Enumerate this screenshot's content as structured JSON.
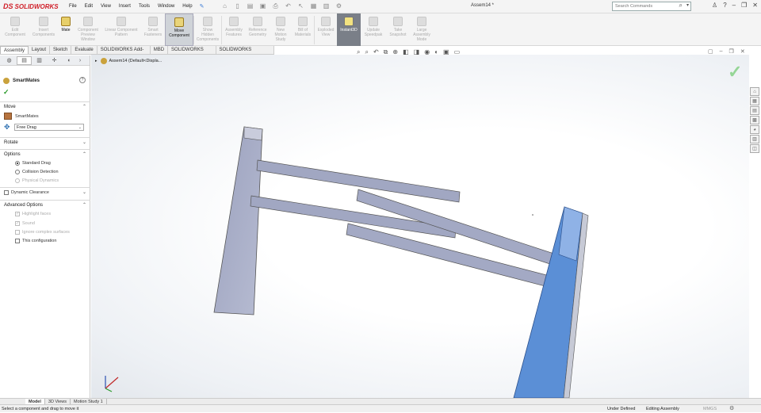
{
  "app": {
    "brand": "SOLIDWORKS",
    "brand_glyph": "DS",
    "doc_title": "Assem14 *"
  },
  "menu": [
    "File",
    "Edit",
    "View",
    "Insert",
    "Tools",
    "Window",
    "Help"
  ],
  "search": {
    "placeholder": "Search Commands"
  },
  "ribbon": [
    {
      "label": "Edit\nComponent",
      "state": "disabled"
    },
    {
      "label": "Insert\nComponents",
      "state": "disabled"
    },
    {
      "label": "Mate",
      "state": "active"
    },
    {
      "label": "Component\nPreview\nWindow",
      "state": "disabled"
    },
    {
      "label": "Linear Component\nPattern",
      "state": "disabled"
    },
    {
      "label": "Smart\nFasteners",
      "state": "disabled"
    },
    {
      "label": "Move\nComponent",
      "state": "pressed"
    },
    {
      "label": "Show\nHidden\nComponents",
      "state": "disabled"
    },
    {
      "label": "Assembly\nFeatures",
      "state": "disabled"
    },
    {
      "label": "Reference\nGeometry",
      "state": "disabled"
    },
    {
      "label": "New\nMotion\nStudy",
      "state": "disabled"
    },
    {
      "label": "Bill of\nMaterials",
      "state": "disabled"
    },
    {
      "label": "Exploded\nView",
      "state": "disabled"
    },
    {
      "label": "Instant3D",
      "state": "dark"
    },
    {
      "label": "Update\nSpeedpak",
      "state": "disabled"
    },
    {
      "label": "Take\nSnapshot",
      "state": "disabled"
    },
    {
      "label": "Large\nAssembly\nMode",
      "state": "disabled"
    }
  ],
  "command_tabs": [
    "Assembly",
    "Layout",
    "Sketch",
    "Evaluate",
    "SOLIDWORKS Add-Ins",
    "MBD",
    "SOLIDWORKS CAM",
    "SOLIDWORKS Inspection"
  ],
  "property_manager": {
    "title": "SmartMates",
    "sections": {
      "move": {
        "label": "Move",
        "smartmates": "SmartMates",
        "mode": "Free Drag"
      },
      "rotate": {
        "label": "Rotate"
      },
      "options": {
        "label": "Options",
        "standard_drag": "Standard Drag",
        "collision_detection": "Collision Detection",
        "physical_dynamics": "Physical Dynamics"
      },
      "dynamic_clearance": {
        "label": "Dynamic Clearance"
      },
      "advanced": {
        "label": "Advanced Options",
        "highlight_faces": "Highlight faces",
        "sound": "Sound",
        "ignore_complex": "Ignore complex surfaces",
        "this_configuration": "This configuration"
      }
    }
  },
  "tree": {
    "root": "Assem14  (Default<Displa..."
  },
  "bottom_tabs": [
    "Model",
    "3D Views",
    "Motion Study 1"
  ],
  "status": {
    "message": "Select a component and drag to move it",
    "defined": "Under Defined",
    "mode": "Editing Assembly",
    "units": "MMGS"
  },
  "colors": {
    "brand": "#d0202a",
    "part": "#a7adc4",
    "selected": "#5b8fd6"
  }
}
